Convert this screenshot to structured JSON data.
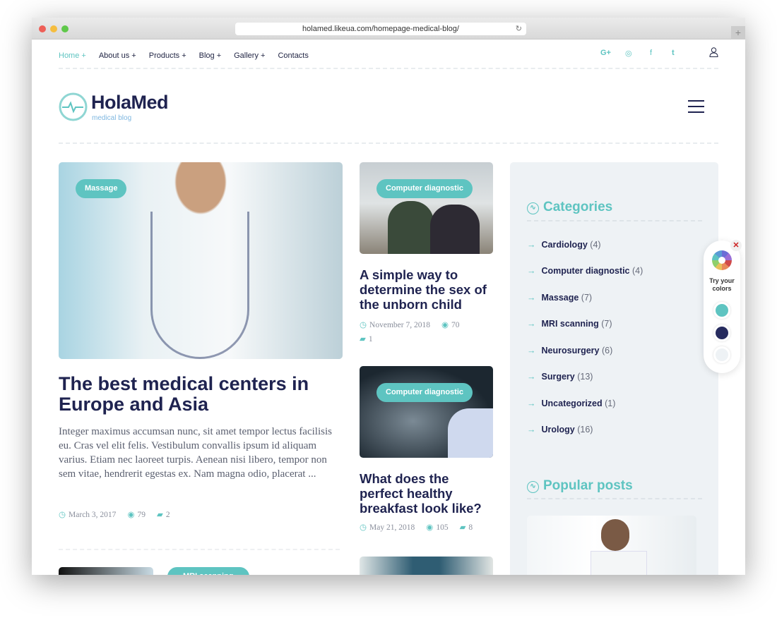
{
  "browser": {
    "url": "holamed.likeua.com/homepage-medical-blog/"
  },
  "nav": {
    "items": [
      "Home +",
      "About us +",
      "Products +",
      "Blog +",
      "Gallery +",
      "Contacts"
    ],
    "active": 0
  },
  "social": [
    "google-plus-icon",
    "instagram-icon",
    "facebook-icon",
    "twitter-icon"
  ],
  "social_glyphs": [
    "G+",
    "◎",
    "f",
    "t"
  ],
  "logo": {
    "name": "HolaMed",
    "tagline": "medical blog"
  },
  "colors": {
    "accent": "#5ec4c1",
    "navy": "#1f2350",
    "sidebar_bg": "#eef2f5"
  },
  "posts": [
    {
      "tag": "Massage",
      "title": "The best medical centers in Europe and Asia",
      "excerpt": "Integer maximus accumsan nunc, sit amet tempor lectus facilisis eu. Cras vel elit felis. Vestibulum convallis ipsum id aliquam varius. Etiam nec laoreet turpis. Aenean nisi libero, tempor non sem vitae, hendrerit egestas ex. Nam magna odio, placerat ...",
      "date": "March 3, 2017",
      "views": "79",
      "comments": "2"
    },
    {
      "tag": "Computer diagnostic",
      "title": "A simple way to determine the sex of the unborn child",
      "date": "November 7, 2018",
      "views": "70",
      "comments": "1"
    },
    {
      "tag": "Computer diagnostic",
      "title": "What does the perfect healthy breakfast look like?",
      "date": "May 21, 2018",
      "views": "105",
      "comments": "8"
    }
  ],
  "partial_tag": "MRI scanning",
  "sidebar": {
    "categories_title": "Categories",
    "categories": [
      {
        "name": "Cardiology",
        "count": "(4)"
      },
      {
        "name": "Computer diagnostic",
        "count": "(4)"
      },
      {
        "name": "Massage",
        "count": "(7)"
      },
      {
        "name": "MRI scanning",
        "count": "(7)"
      },
      {
        "name": "Neurosurgery",
        "count": "(6)"
      },
      {
        "name": "Surgery",
        "count": "(13)"
      },
      {
        "name": "Uncategorized",
        "count": "(1)"
      },
      {
        "name": "Urology",
        "count": "(16)"
      }
    ],
    "popular_title": "Popular posts"
  },
  "picker": {
    "label": "Try your colors",
    "swatches": [
      "#5ec4c1",
      "#262b5e",
      "#eef2f5"
    ]
  }
}
